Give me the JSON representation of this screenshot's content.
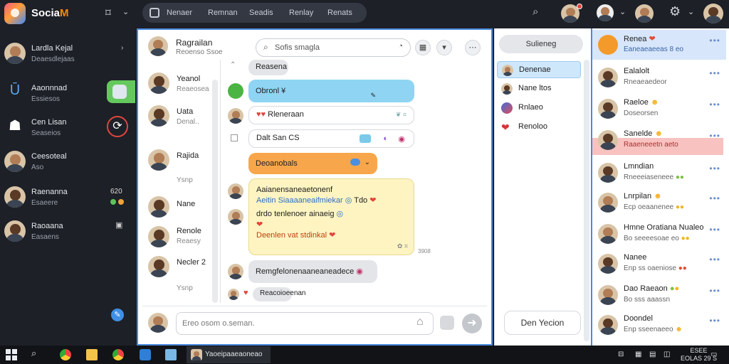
{
  "app": {
    "logo_prefix": "Socia",
    "logo_suffix": "M"
  },
  "nav": {
    "items": [
      "Nenaer",
      "Remnan",
      "Seadis",
      "Renlay",
      "Renats"
    ]
  },
  "rail": {
    "items": [
      {
        "name": "Lardla Kejal",
        "sub": "Deaesdlejaas"
      },
      {
        "name": "Aaonnnad",
        "sub": "Essiesos"
      },
      {
        "name": "Cen Lisan",
        "sub": "Seaseios"
      },
      {
        "name": "Ceesoteal",
        "sub": "Aso"
      },
      {
        "name": "Raenanna",
        "sub": "Esaeere"
      },
      {
        "name": "Raoaana",
        "sub": "Easaens"
      }
    ],
    "count": "620"
  },
  "chat": {
    "title": "Ragrailan",
    "subtitle": "Reoenso Ssoe",
    "search_placeholder": "Sofis smagla",
    "conversations": [
      {
        "name": "Yeanol",
        "sub": "Reaeosea"
      },
      {
        "name": "Uata",
        "sub": "Denal.."
      },
      {
        "name": "Rajida",
        "sub": "Ysnp"
      },
      {
        "name": "Nane",
        "sub": ""
      },
      {
        "name": "Renole",
        "sub": "Reaesy"
      },
      {
        "name": "Necler 2",
        "sub": "Ysnp"
      }
    ],
    "messages": [
      {
        "text": "Reasena"
      },
      {
        "text": "Obronl ¥"
      },
      {
        "text": "Rleneraan"
      },
      {
        "text": "Dalt San CS"
      },
      {
        "text": "Deoanobals"
      },
      {
        "line1": "Aaianensaneaetonenf",
        "line2": "Aeitin Siaaaaneaifmiekar",
        "line3": "Tdo",
        "line4": "drdo tenlenoer ainaeig",
        "line5": "Deenlen vat stdinkal",
        "time": "3908"
      },
      {
        "text": "Remgfelonenaaneaneadece"
      },
      {
        "text": "Reacoioeenan"
      }
    ],
    "composer_placeholder": "Ereo osom o.seman."
  },
  "mid": {
    "header": "Sulieneg",
    "items": [
      "Denenae",
      "Nane ltos",
      "Rnlaeo",
      "Renoloo"
    ],
    "footer": "Den Yecion"
  },
  "contacts": [
    {
      "name": "Renea",
      "status": "Eaneaeaeeas 8 eo"
    },
    {
      "name": "Ealalolt",
      "status": "Rneaeaedeor"
    },
    {
      "name": "Raeloe",
      "status": "Doseorsen"
    },
    {
      "name": "Sanelde",
      "status": "Raaeneeetn aeto"
    },
    {
      "name": "Lmndian",
      "status": "Rneeeiaseneee"
    },
    {
      "name": "Lnrpilan",
      "status": "Ecp oeaanenee"
    },
    {
      "name": "Hmne Oratiana Nualeo",
      "status": "Bo seeeesoae eo"
    },
    {
      "name": "Nanee",
      "status": "Enp ss oaeniose"
    },
    {
      "name": "Dao Raeaon",
      "status": "Bo sss aaassn"
    },
    {
      "name": "Doondel",
      "status": "Enp sseenaeeo"
    }
  ],
  "taskbar": {
    "window_title": "Yaoeipaaeaoneao",
    "lang": "ESEE",
    "time": "EOLAS 29 S"
  }
}
